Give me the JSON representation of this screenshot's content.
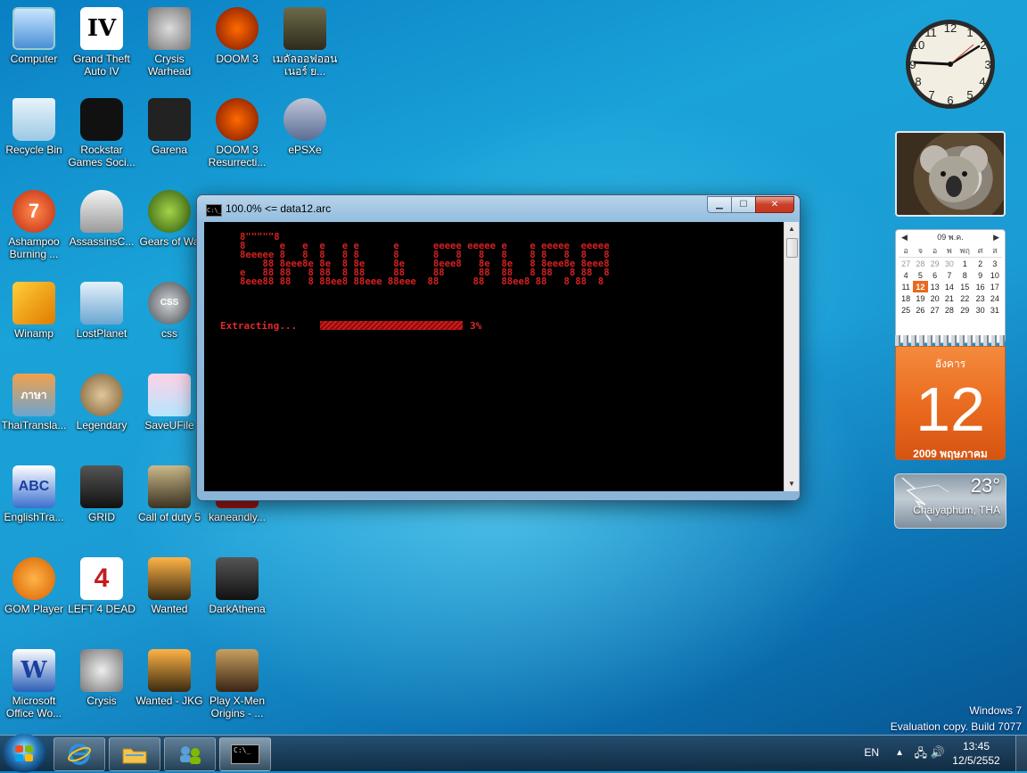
{
  "desktop": {
    "icons": [
      {
        "label": "Computer"
      },
      {
        "label": "Grand Theft Auto IV",
        "badge": "IV"
      },
      {
        "label": "Crysis Warhead"
      },
      {
        "label": "DOOM 3"
      },
      {
        "label": "เมดัลออฟออนเนอร์ ย..."
      },
      {
        "label": "Recycle Bin"
      },
      {
        "label": "Rockstar Games Soci..."
      },
      {
        "label": "Garena"
      },
      {
        "label": "DOOM 3 Resurrecti..."
      },
      {
        "label": "ePSXe"
      },
      {
        "label": "Ashampoo Burning ...",
        "badge": "7"
      },
      {
        "label": "AssassinsC..."
      },
      {
        "label": "Gears of Wa"
      },
      {
        "label": "Winamp"
      },
      {
        "label": "LostPlanet"
      },
      {
        "label": "css",
        "badge": "CSS"
      },
      {
        "label": "ThaiTransla...",
        "badge": "ภาษา"
      },
      {
        "label": "Legendary"
      },
      {
        "label": "SaveUFile"
      },
      {
        "label": "EnglishTra...",
        "badge": "ABC"
      },
      {
        "label": "GRID"
      },
      {
        "label": "Call of duty 5"
      },
      {
        "label": "kaneandly..."
      },
      {
        "label": "GOM Player"
      },
      {
        "label": "LEFT 4 DEAD",
        "badge": "4"
      },
      {
        "label": "Wanted"
      },
      {
        "label": "DarkAthena"
      },
      {
        "label": "Microsoft Office Wo...",
        "badge": "W"
      },
      {
        "label": "Crysis"
      },
      {
        "label": "Wanted - JKG"
      },
      {
        "label": "Play X-Men Origins - ..."
      }
    ]
  },
  "console_window": {
    "title": "100.0% <= data12.arc",
    "icon_text": "C:\\_",
    "art": "8\"\"\"\"\"8\n8      e   e  e   e e      e      eeeee eeeee e    e eeeee  eeeee\n8eeeee 8   8  8   8 8      8      8   8   8   8    8 8   8  8   8\n    88 8eee8e 8e  8 8e     8e     8eee8   8e  8e   8 8eee8e 8eee8\ne   88 88   8 88  8 88     88     88      88  88   8 88   8 88  8\n8eee88 88   8 88ee8 88eee 88eee  88      88   88ee8 88   8 88  8",
    "status_label": "Extracting...",
    "progress_percent": "3%",
    "progress_value": 0.03
  },
  "gadgets": {
    "calendar": {
      "month_label": "09 พ.ค.",
      "weekdays": [
        "อ",
        "จ",
        "อ",
        "พ",
        "พฤ",
        "ศ",
        "ส"
      ],
      "weeks": [
        [
          "27",
          "28",
          "29",
          "30",
          "1",
          "2",
          "3"
        ],
        [
          "4",
          "5",
          "6",
          "7",
          "8",
          "9",
          "10"
        ],
        [
          "11",
          "12",
          "13",
          "14",
          "15",
          "16",
          "17"
        ],
        [
          "18",
          "19",
          "20",
          "21",
          "22",
          "23",
          "24"
        ],
        [
          "25",
          "26",
          "27",
          "28",
          "29",
          "30",
          "31"
        ]
      ],
      "today": "12"
    },
    "day_card": {
      "day_name": "อังคาร",
      "day_number": "12",
      "month_year": "2009 พฤษภาคม"
    },
    "weather": {
      "temperature": "23°",
      "location": "Chaiyaphum, THA"
    }
  },
  "watermark": {
    "line1": "Windows 7",
    "line2": "Evaluation copy. Build 7077"
  },
  "taskbar": {
    "language": "EN",
    "time": "13:45",
    "date": "12/5/2552",
    "active_icon_text": "C:\\_"
  },
  "colors": {
    "console_text": "#d42020",
    "accent_orange": "#e96a1e"
  }
}
